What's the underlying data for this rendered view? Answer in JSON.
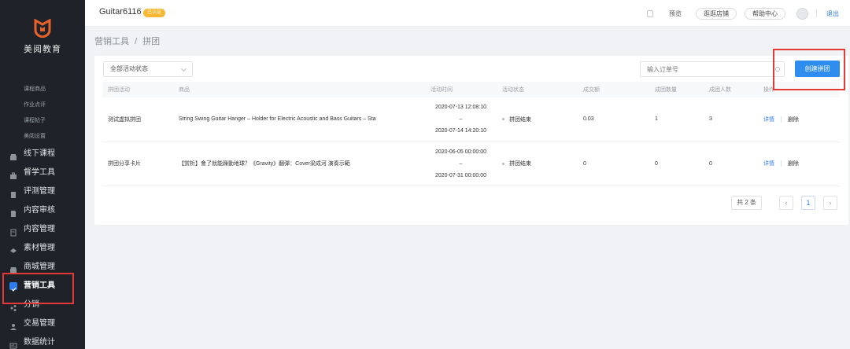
{
  "sidebar": {
    "brand": "美阅教育",
    "brand_color": "#e8622a",
    "sub_items": [
      "课程商品",
      "作业点评",
      "课程帖子",
      "美阅设置"
    ],
    "items": [
      {
        "label": "线下课程",
        "icon": "building-icon"
      },
      {
        "label": "督学工具",
        "icon": "briefcase-icon"
      },
      {
        "label": "评测管理",
        "icon": "clipboard-icon"
      },
      {
        "label": "内容审核",
        "icon": "document-icon"
      },
      {
        "label": "内容管理",
        "icon": "file-icon"
      },
      {
        "label": "素材管理",
        "icon": "layers-icon"
      },
      {
        "label": "商城管理",
        "icon": "store-icon"
      },
      {
        "label": "营销工具",
        "icon": "marketing-icon"
      },
      {
        "label": "分销",
        "icon": "share-icon"
      },
      {
        "label": "交易管理",
        "icon": "person-icon"
      },
      {
        "label": "数据统计",
        "icon": "chart-icon"
      }
    ],
    "active": "营销工具",
    "accent": "#2f7cf0"
  },
  "header": {
    "shop_name": "Guitar6116",
    "badge": "已认证",
    "preview": "预览",
    "visit_store": "逛逛店铺",
    "help": "帮助中心",
    "logout": "退出"
  },
  "breadcrumb": {
    "parent": "营销工具",
    "separator": "/",
    "current": "拼团"
  },
  "filters": {
    "status_select": "全部活动状态",
    "search_placeholder": "输入订单号",
    "create_button": "创建拼团"
  },
  "table": {
    "columns": [
      "拼团活动",
      "商品",
      "活动时间",
      "活动状态",
      "成交额",
      "成团数量",
      "成团人数",
      "操作"
    ],
    "rows": [
      {
        "activity": "测试虚拟拼团",
        "product": "String Swing Guitar Hanger – Holder for Electric Acoustic and Bass Guitars – Sta",
        "start": "2020-07-13 12:08:10",
        "dash": "–",
        "end": "2020-07-14 14:20:10",
        "status": "拼团结束",
        "amount": "0.03",
        "groups": "1",
        "people": "3",
        "detail": "详情",
        "delete": "删除"
      },
      {
        "activity": "拼团分享卡片",
        "product": "【赏析】會了就能躁動地球？《Gravity》翻彈：Cover梁成河 演奏示範",
        "start": "2020-06-05 00:00:00",
        "dash": "–",
        "end": "2020-07-31 00:00:00",
        "status": "拼团结束",
        "amount": "0",
        "groups": "0",
        "people": "0",
        "detail": "详情",
        "delete": "删除"
      }
    ]
  },
  "pagination": {
    "total": "共 2 条",
    "prev": "‹",
    "page": "1",
    "next": "›"
  }
}
